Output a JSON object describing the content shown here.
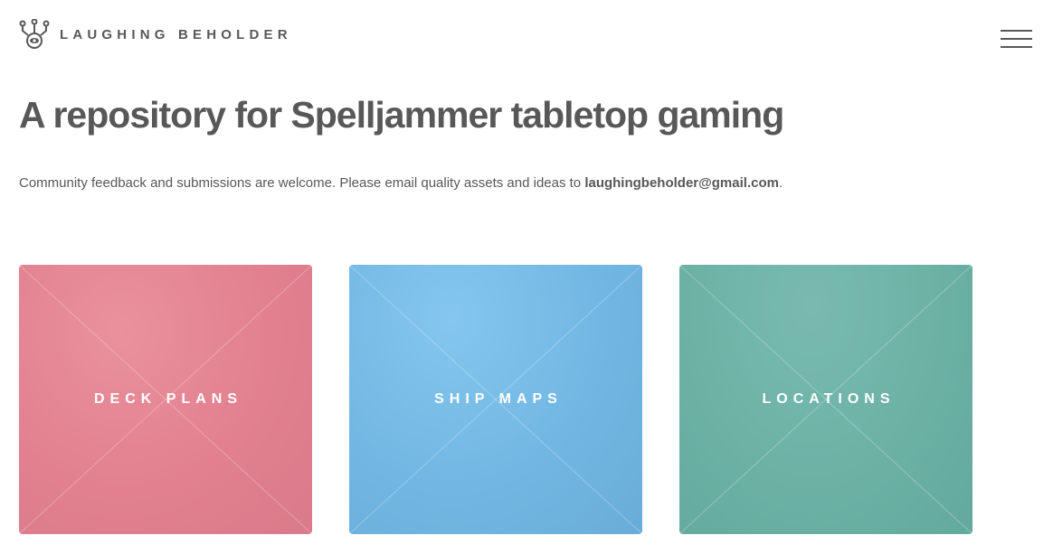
{
  "header": {
    "site_name": "LAUGHING BEHOLDER",
    "logo_icon": "beholder-logo-icon",
    "menu_icon": "hamburger-menu-icon"
  },
  "main": {
    "title": "A repository for Spelljammer tabletop gaming",
    "intro_text": "Community feedback and submissions are welcome. Please email quality assets and ideas to ",
    "intro_email": "laughingbeholder@gmail.com",
    "intro_end": "."
  },
  "tiles": [
    {
      "label": "DECK PLANS",
      "color": "#e2808f"
    },
    {
      "label": "SHIP MAPS",
      "color": "#72b7e3"
    },
    {
      "label": "LOCATIONS",
      "color": "#6db1a5"
    }
  ],
  "colors": {
    "text": "#585858",
    "background": "#ffffff"
  }
}
